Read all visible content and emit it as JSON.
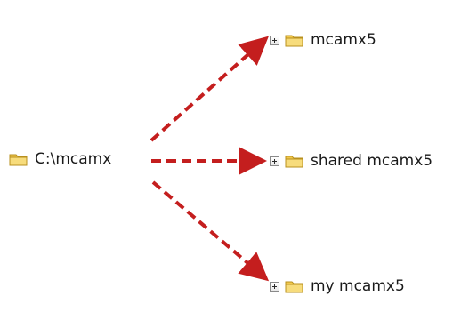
{
  "diagram": {
    "root": {
      "label": "C:\\mcamx",
      "icon": "folder-icon"
    },
    "children": [
      {
        "label": "mcamx5",
        "icon": "folder-icon",
        "expander": "plus-box-icon"
      },
      {
        "label": "shared mcamx5",
        "icon": "folder-icon",
        "expander": "plus-box-icon"
      },
      {
        "label": "my mcamx5",
        "icon": "folder-icon",
        "expander": "plus-box-icon"
      }
    ],
    "arrow_color": "#c41e1e",
    "folder_color": "#f2c94c"
  }
}
